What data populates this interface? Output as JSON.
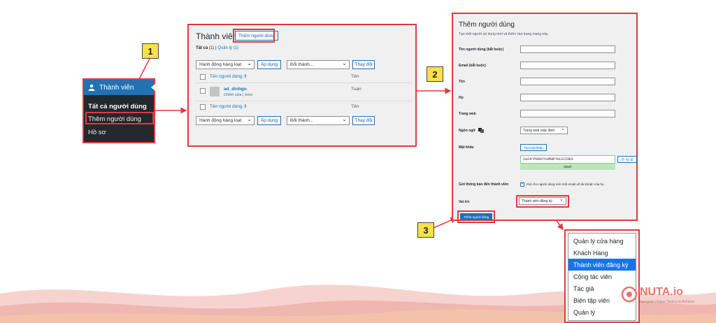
{
  "steps": [
    "1",
    "2",
    "3"
  ],
  "admin_menu": {
    "section": "Thành viên",
    "items": [
      "Tất cả người dùng",
      "Thêm người dùng",
      "Hồ sơ"
    ]
  },
  "users_page": {
    "title": "Thành viên",
    "add_button": "Thêm người dùng",
    "filter_all": "Tất cả",
    "filter_all_count": "(1)",
    "filter_separator": "|",
    "filter_admin": "Quản lý",
    "filter_admin_count": "(1)",
    "bulk_action": "Hành động hàng loạt",
    "apply": "Áp dụng",
    "change_role": "Đổi thành...",
    "change": "Thay đổi",
    "col_username": "Tên người dùng",
    "sort_icon": "⇕",
    "col_name": "Tên",
    "row": {
      "username": "ad_dinhgo",
      "actions": "Chỉnh sửa | Xem",
      "name": "Tuan"
    }
  },
  "add_user_form": {
    "title": "Thêm người dùng",
    "subtitle": "Tạo một người sử dụng mới và thêm vào trang mạng này.",
    "labels": {
      "username": "Tên người dùng (bắt buộc)",
      "email": "Email (bắt buộc)",
      "first_name": "Tên",
      "last_name": "Họ",
      "website": "Trang web",
      "language": "Ngôn ngữ",
      "password": "Mật khẩu",
      "notify": "Gửi thông báo đến thành viên",
      "role": "Vai trò"
    },
    "language_value": "Trang web mặc định",
    "generate_password": "Tạo mật khẩu",
    "password_value": "2a24^P08GT#sM8R^N1SII9EX",
    "hide_button": "Ẩn đi",
    "strength": "Mạnh",
    "notify_text": "Gửi cho người dùng mới một email về tài khoản của họ",
    "role_value": "Thành viên đăng ký",
    "submit": "Thêm người dùng"
  },
  "role_dropdown": {
    "options": [
      "Quản lý cửa hàng",
      "Khách Hàng",
      "Thành viên đăng ký",
      "Cộng tác viên",
      "Tác giả",
      "Biên tập viên",
      "Quản lý"
    ],
    "selected_index": 2
  },
  "logo": {
    "name": "NUTA.io",
    "tagline": "Navigate Unique Tactics to Achieve"
  },
  "colors": {
    "highlight": "#e0393e",
    "wp_blue": "#2271b1",
    "badge": "#f7e14b"
  }
}
